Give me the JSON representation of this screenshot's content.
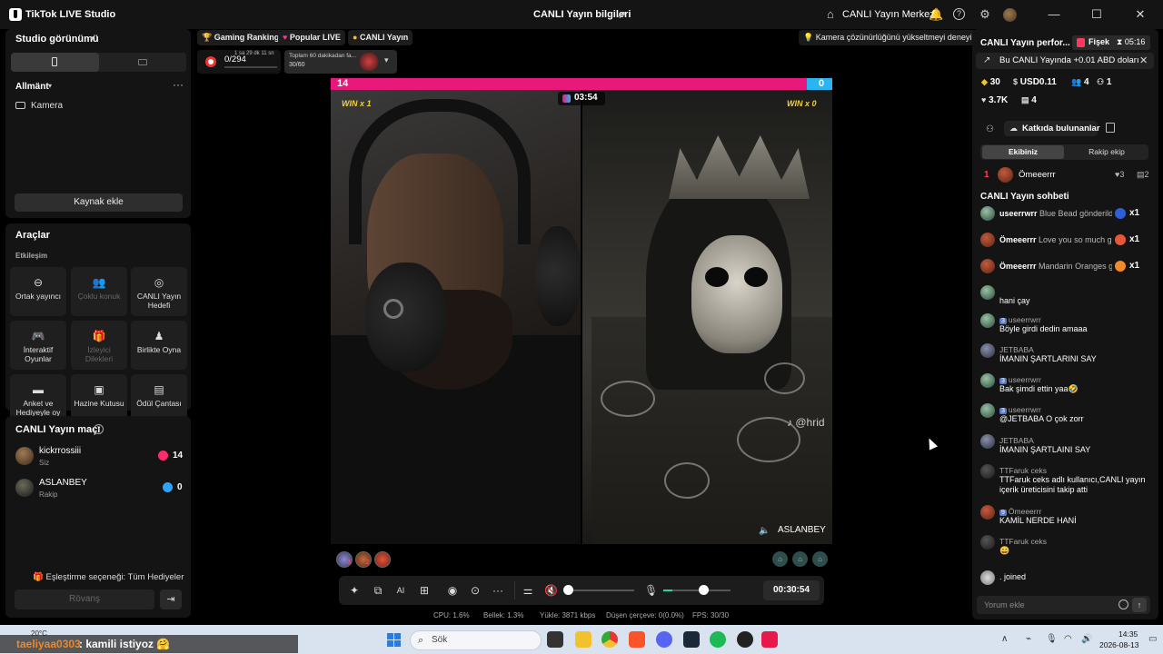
{
  "titlebar": {
    "app_name": "TikTok LIVE Studio",
    "center_title": "CANLI Yayın bilgileri",
    "center_link": "CANLI Yayın Merkezi"
  },
  "left": {
    "studio_view_label": "Studio görünümü",
    "scene_label": "Allmänt",
    "camera_label": "Kamera",
    "add_source_label": "Kaynak ekle",
    "tools_title": "Araçlar",
    "interaction_label": "Etkileşim",
    "tools": [
      {
        "icon": "link-icon",
        "glyph": "⊖",
        "label": "Ortak yayıncı",
        "enabled": true
      },
      {
        "icon": "multi-guest-icon",
        "glyph": "👥",
        "label": "Çoklu konuk",
        "enabled": false
      },
      {
        "icon": "target-icon",
        "glyph": "◎",
        "label": "CANLI Yayın Hedefi",
        "enabled": true
      },
      {
        "icon": "gamepad-icon",
        "glyph": "🎮",
        "label": "İnteraktif Oyunlar",
        "enabled": true
      },
      {
        "icon": "gift-icon",
        "glyph": "🎁",
        "label": "İzleyici Dilekleri",
        "enabled": false
      },
      {
        "icon": "play-together-icon",
        "glyph": "♟",
        "label": "Birlikte Oyna",
        "enabled": true
      },
      {
        "icon": "poll-icon",
        "glyph": "▬",
        "label": "Anket ve Hediyeyle oy",
        "enabled": true
      },
      {
        "icon": "treasure-box-icon",
        "glyph": "▣",
        "label": "Hazine Kutusu",
        "enabled": true
      },
      {
        "icon": "reward-bag-icon",
        "glyph": "▤",
        "label": "Ödül Çantası",
        "enabled": true
      }
    ],
    "match_title": "CANLI Yayın maçı",
    "players": [
      {
        "name": "kickrrossiii",
        "sub": "Siz",
        "score": "14"
      },
      {
        "name": "ASLANBEY",
        "sub": "Rakip",
        "score": "0"
      }
    ],
    "pairing_label": "Eşleştirme seçeneği: Tüm Hediyeler",
    "rematch_label": "Rövanş"
  },
  "center": {
    "chips": [
      "Gaming Ranking",
      "Popular LIVE",
      "CANLI Yayın"
    ],
    "tip": "Kamera çözünürlüğünü yükseltmeyi deneyin",
    "gift_count": "0/294",
    "gift_time": "1 sa 29 dk 11 sn",
    "goal_text": "Toplam 60 dakikadan fa...",
    "goal_count": "30/60",
    "battle": {
      "score_left": "14",
      "score_right": "0",
      "score_left_fraction": 0.95,
      "win_left": "WIN x 1",
      "win_right": "WIN x 0",
      "timer": "03:54",
      "watermark": "@hrid",
      "opponent_name": "ASLANBEY"
    },
    "viewer_badges": [
      "3",
      "2",
      ""
    ],
    "live_timer": "00:30:54",
    "speaker_volume": 0.0,
    "mic_volume": 0.6
  },
  "stats": {
    "cpu": "CPU:  1.6%",
    "memory": "Bellek:  1.3%",
    "upload": "Yükle:  3871 kbps",
    "dropped": "Düşen çerçeve:  0(0.0%)",
    "fps": "FPS:  30/30"
  },
  "right": {
    "perf_title": "CANLI Yayın perfor...",
    "fisek_label": "Fişek",
    "fisek_time": "05:16",
    "promo_text": "Bu CANLI Yayında +0.01 ABD doları",
    "metrics": {
      "diamonds": "30",
      "earnings": "USD0.11",
      "viewers": "4",
      "new_followers": "1",
      "likes": "3.7K",
      "gifters": "4"
    },
    "contributors_label": "Katkıda bulunanlar",
    "team_ours": "Ekibiniz",
    "team_theirs": "Rakip ekip",
    "rank": {
      "num": "1",
      "name": "Ömeeerrr",
      "likes": "3",
      "gifts": "2"
    },
    "chat_title": "CANLI Yayın sohbeti",
    "gift_events": [
      {
        "user": "useerrwrr",
        "text": "Blue Bead gönderildi",
        "count": "x1",
        "color": "#2d5fd8"
      },
      {
        "user": "Ömeeerrr",
        "text": "Love you so much gönderildi",
        "count": "x1",
        "color": "#e8563a"
      },
      {
        "user": "Ömeeerrr",
        "text": "Mandarin Oranges gönderildi",
        "count": "x1",
        "color": "#f08a2a"
      }
    ],
    "messages": [
      {
        "user": "",
        "level": "",
        "text": "hani çay",
        "av": "av-user"
      },
      {
        "user": "useerrwrr",
        "level": "3",
        "text": "Böyle girdi dedin amaaa",
        "av": "av-user"
      },
      {
        "user": "JETBABA",
        "level": "",
        "text": "İMANIN ŞARTLARINI SAY",
        "av": "av-jet"
      },
      {
        "user": "useerrwrr",
        "level": "3",
        "text": "Bak şimdi ettin yaa🤣",
        "av": "av-user"
      },
      {
        "user": "useerrwrr",
        "level": "3",
        "text": "@JETBABA O çok zorr",
        "av": "av-user"
      },
      {
        "user": "JETBABA",
        "level": "",
        "text": "İMANIN ŞARTLAINI SAY",
        "av": "av-jet"
      },
      {
        "user": "TTFaruk ceks",
        "level": "",
        "text": "TTFaruk ceks adlı kullanıcı,CANLI yayın içerik üreticisini takip atti",
        "av": "av-ttf"
      },
      {
        "user": "Ömeeerrr",
        "level": "9",
        "text": "KAMİL NERDE HANİ",
        "av": "av-omer"
      },
      {
        "user": "TTFaruk ceks",
        "level": "",
        "text": "😄",
        "av": "av-ttf"
      }
    ],
    "joined_text": ". joined",
    "comment_placeholder": "Yorum ekle"
  },
  "taskbar": {
    "weather": "20°C",
    "overlay_user": "taeliyaa0303",
    "overlay_msg": ": kamili istiyoz 🤗",
    "search_placeholder": "Sök",
    "time": "14:35",
    "date": "2026-08-13"
  }
}
